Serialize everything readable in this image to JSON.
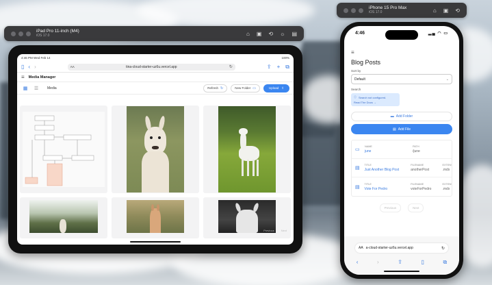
{
  "ipad_sim": {
    "title": "iPad Pro 11-inch (M4)",
    "os": "iOS 17.0",
    "icons": [
      "home-icon",
      "screenshot-icon",
      "rotate-icon",
      "appearance-icon",
      "save-icon"
    ]
  },
  "iphone_sim": {
    "title": "iPhone 15 Pro Max",
    "os": "iOS 17.0",
    "icons": [
      "home-icon",
      "screenshot-icon",
      "rotate-icon"
    ]
  },
  "ipad": {
    "status": {
      "time": "4:46 PM",
      "date": "Wed Feb 14",
      "battery": "100%"
    },
    "url": "tina-cloud-starter-uz6u.vercel.app",
    "url_aa": "AA",
    "app_title": "Media Manager",
    "breadcrumb": "Media",
    "buttons": {
      "refresh": "Refresh",
      "new_folder": "New Folder",
      "upload": "Upload"
    },
    "pager": {
      "prev": "Previous",
      "next": "Next"
    }
  },
  "iphone": {
    "time": "4:46",
    "title": "Blog Posts",
    "sort_label": "Sort by",
    "sort_value": "Default",
    "search_label": "Search",
    "alert_text": "Search not configured.",
    "alert_link": "Read The Docs →",
    "add_folder": "Add Folder",
    "add_file": "Add File",
    "rows": [
      {
        "type": "folder",
        "h1": "NAME",
        "v1": "june",
        "h2": "PATH",
        "v2": "/june",
        "h3": "",
        "v3": ""
      },
      {
        "type": "file",
        "h1": "TITLE",
        "v1": "Just Another Blog Post",
        "h2": "FILENAME",
        "v2": "anotherPost",
        "h3": "EXTENSION",
        "v3": ".mdx"
      },
      {
        "type": "file",
        "h1": "TITLE",
        "v1": "Vote For Pedro",
        "h2": "FILENAME",
        "v2": "voteForPedro",
        "h3": "EXTENSION",
        "v3": ".mdx"
      }
    ],
    "pager": {
      "prev": "Previous",
      "next": "Next"
    },
    "url_aa": "AA",
    "url": "a-cloud-starter-uz6u.vercel.app"
  },
  "colors": {
    "accent": "#3b86f0",
    "sim_bar": "#3a3a3c"
  }
}
